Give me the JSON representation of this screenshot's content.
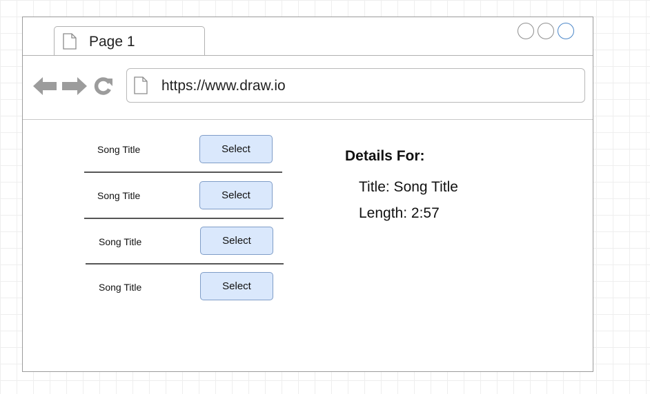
{
  "browser": {
    "tab": {
      "label": "Page 1",
      "icon": "page-icon"
    },
    "window_controls": [
      "minimize-button",
      "maximize-button",
      "close-button"
    ],
    "nav": {
      "back_icon": "arrow-left-icon",
      "forward_icon": "arrow-right-icon",
      "refresh_icon": "refresh-icon"
    },
    "address": {
      "icon": "page-icon",
      "url": "https://www.draw.io"
    }
  },
  "songs": [
    {
      "title": "Song Title",
      "button_label": "Select"
    },
    {
      "title": "Song Title",
      "button_label": "Select"
    },
    {
      "title": "Song Title",
      "button_label": "Select"
    },
    {
      "title": "Song Title",
      "button_label": "Select"
    }
  ],
  "details": {
    "heading": "Details For:",
    "title_line": "Title: Song Title",
    "length_line": "Length: 2:57"
  },
  "colors": {
    "select_button_fill": "#dae8fc",
    "select_button_border": "#7e9cc7",
    "close_button_accent": "#4a86c8",
    "nav_icon_fill": "#9c9c9c"
  }
}
